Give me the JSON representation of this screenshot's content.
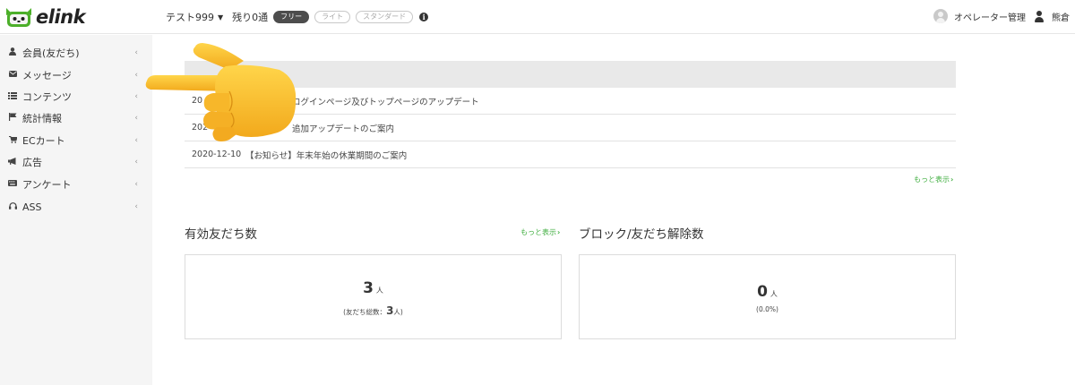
{
  "header": {
    "logo_text": "elink",
    "account_name": "テスト999",
    "remaining": "残り0通",
    "plans": [
      {
        "label": "フリー",
        "active": true
      },
      {
        "label": "ライト",
        "active": false
      },
      {
        "label": "スタンダード",
        "active": false
      }
    ],
    "operator_label": "オペレーター管理",
    "user_name": "熊倉"
  },
  "sidebar": {
    "items": [
      {
        "label": "会員(友だち)",
        "icon": "user-icon"
      },
      {
        "label": "メッセージ",
        "icon": "envelope-icon"
      },
      {
        "label": "コンテンツ",
        "icon": "list-icon"
      },
      {
        "label": "統計情報",
        "icon": "flag-icon"
      },
      {
        "label": "ECカート",
        "icon": "cart-icon"
      },
      {
        "label": "広告",
        "icon": "megaphone-icon"
      },
      {
        "label": "アンケート",
        "icon": "keyboard-icon"
      },
      {
        "label": "ASS",
        "icon": "headset-icon"
      }
    ]
  },
  "news": {
    "rows": [
      {
        "date": "20",
        "title": "ログインページ及びトップページのアップデート"
      },
      {
        "date": "202",
        "title": "追加アップデートのご案内"
      },
      {
        "date": "2020-12-10",
        "title": "【お知らせ】年末年始の休業期間のご案内"
      }
    ],
    "more_label": "もっと表示"
  },
  "friends": {
    "title": "有効友だち数",
    "more_label": "もっと表示",
    "count": "3",
    "unit": "人",
    "total_label": "(友だち総数：",
    "total_count": "3",
    "total_suffix": "人)"
  },
  "blocks": {
    "title": "ブロック/友だち解除数",
    "count": "0",
    "unit": "人",
    "percent": "(0.0%)"
  },
  "colors": {
    "accent_green": "#3fae3f",
    "plan_active_bg": "#4d4d4d",
    "sidebar_bg": "#f5f5f5"
  }
}
